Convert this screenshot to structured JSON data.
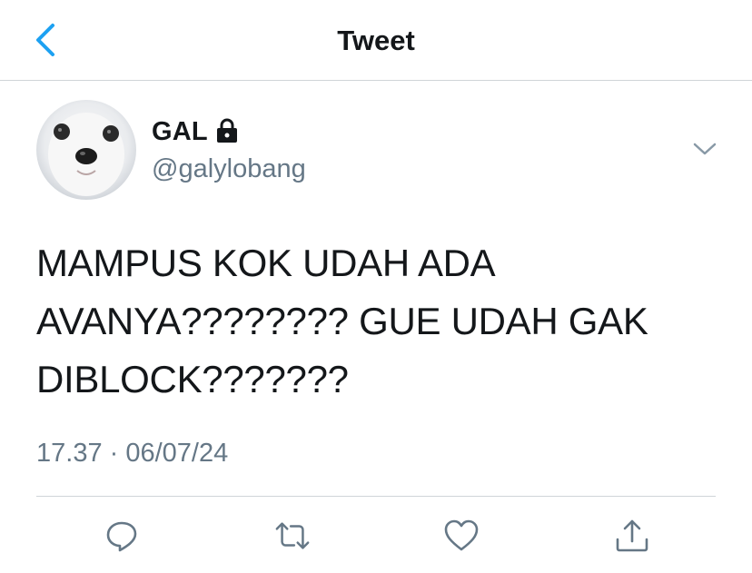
{
  "header": {
    "title": "Tweet",
    "back_icon": "chevron-left-icon"
  },
  "tweet": {
    "author_name": "GAL",
    "protected_icon": "lock-icon",
    "handle": "@galylobang",
    "text_lines": [
      "MAMPUS KOK UDAH ADA",
      "AVANYA???????? GUE UDAH GAK",
      "DIBLOCK???????"
    ],
    "timestamp": "17.37 · 06/07/24"
  },
  "actions": [
    "reply-icon",
    "retweet-icon",
    "like-icon",
    "share-icon"
  ],
  "colors": {
    "accent": "#1da1f2",
    "text": "#14171a",
    "secondary": "#657786",
    "divider": "#d0d4d8"
  }
}
